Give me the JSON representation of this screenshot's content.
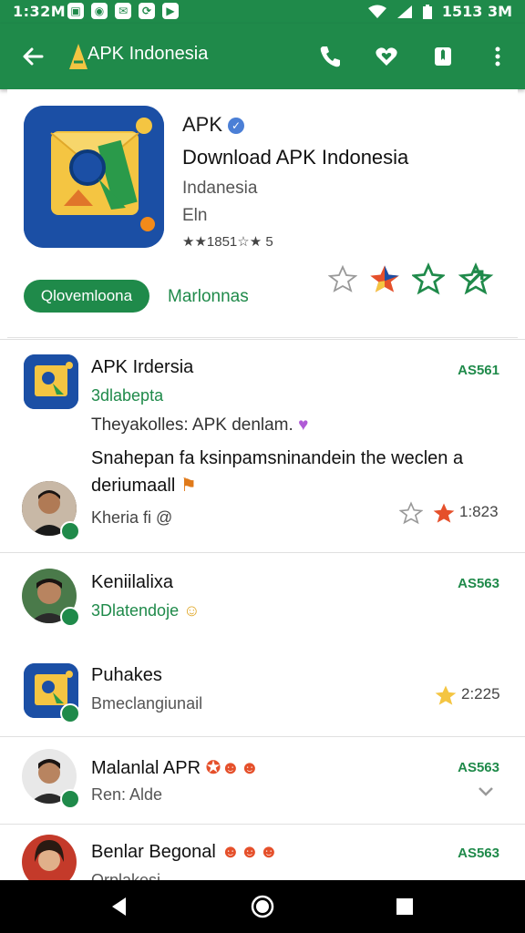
{
  "status": {
    "time_left": "1:32M",
    "time_right": "1513 3M"
  },
  "toolbar": {
    "title": "APK Indonesia"
  },
  "app": {
    "name": "APK",
    "subtitle": "Download APK Indonesia",
    "region": "Indanesia",
    "lang": "Eln",
    "rating": "★★1851☆★ 5",
    "install_label": "Qlovemloona",
    "more_label": "Marlonnas"
  },
  "items": [
    {
      "title": "APK Irdersia",
      "sub": "3dlabepta",
      "ver": "AS561",
      "line1": "Theyakolles: APK denlam.",
      "line2": "Snahepan fa ksinpamsninandein the weclen a",
      "line3": "deriumaall",
      "author": "Kheria fi ",
      "count": "1:823"
    },
    {
      "title": "Keniilalixa",
      "sub": "3Dlatendoje",
      "ver": "AS563"
    },
    {
      "title": "Puhakes",
      "sub": "Bmeclangiunail",
      "count": "2:225"
    },
    {
      "title": "Malanlal APR",
      "sub": "Ren: Alde",
      "ver": "AS563"
    },
    {
      "title": "Benlar Begonal",
      "sub": "Orplakesi",
      "ver": "AS563"
    }
  ],
  "colors": {
    "accent": "#1f8a4a",
    "icon_bg": "#1b4fa5"
  }
}
